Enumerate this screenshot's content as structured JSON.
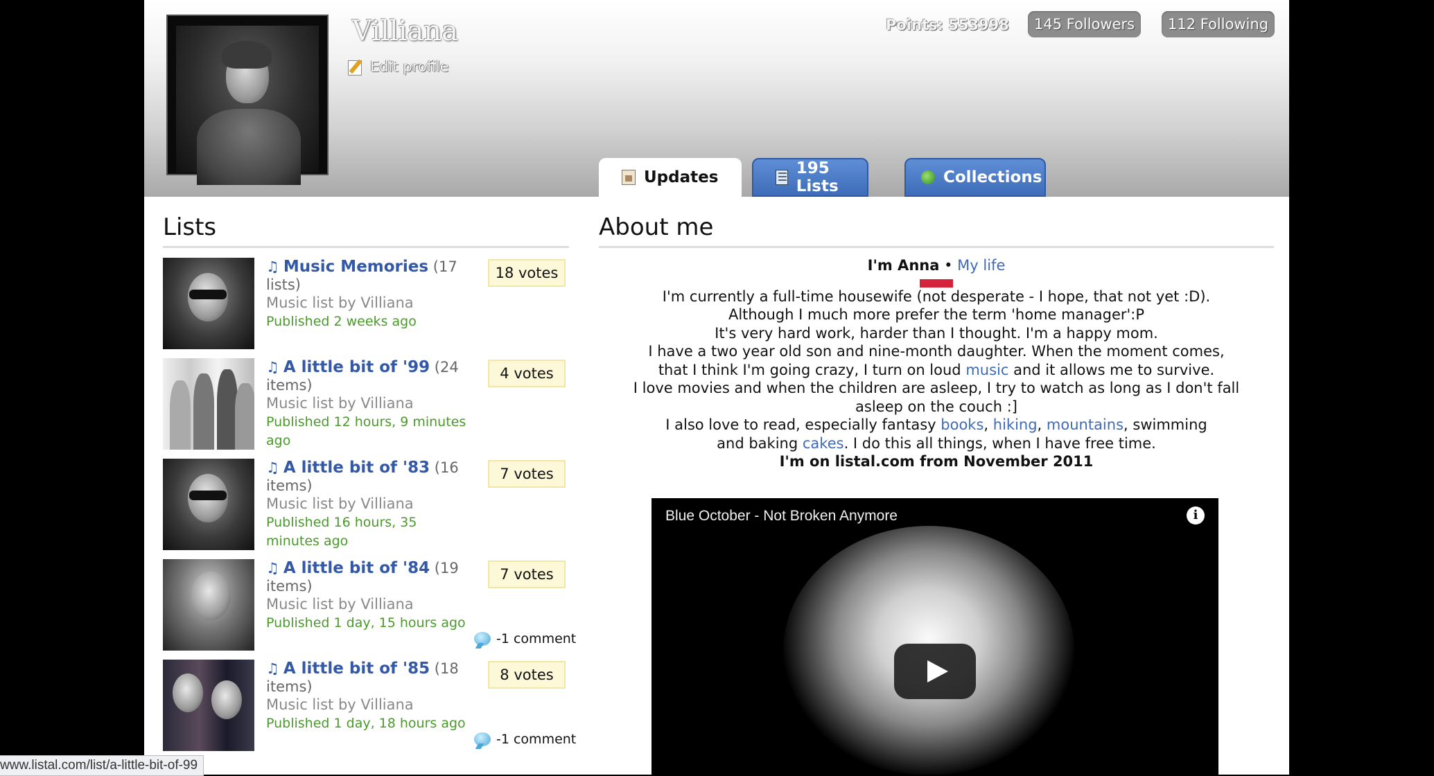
{
  "profile": {
    "username": "Villiana",
    "edit_profile": "Edit profile",
    "points": "Points: 553998",
    "followers": "145 Followers",
    "following": "112 Following"
  },
  "tabs": [
    {
      "label": "Updates"
    },
    {
      "label": "195 Lists"
    },
    {
      "label": "Collections"
    }
  ],
  "lists_section": {
    "title": "Lists",
    "items": [
      {
        "title": "Music Memories",
        "count": "(17 lists)",
        "by": "Music list by Villiana",
        "published": "Published 2 weeks ago",
        "votes": "18 votes",
        "comment": ""
      },
      {
        "title": "A little bit of '99",
        "count": "(24 items)",
        "by": "Music list by Villiana",
        "published": "Published 12 hours, 9 minutes ago",
        "votes": "4 votes",
        "comment": ""
      },
      {
        "title": "A little bit of '83",
        "count": "(16 items)",
        "by": "Music list by Villiana",
        "published": "Published 16 hours, 35 minutes ago",
        "votes": "7 votes",
        "comment": ""
      },
      {
        "title": "A little bit of '84",
        "count": "(19 items)",
        "by": "Music list by Villiana",
        "published": "Published 1 day, 15 hours ago",
        "votes": "7 votes",
        "comment": "-1 comment"
      },
      {
        "title": "A little bit of '85",
        "count": "(18 items)",
        "by": "Music list by Villiana",
        "published": "Published 1 day, 18 hours ago",
        "votes": "8 votes",
        "comment": "-1 comment"
      }
    ]
  },
  "about": {
    "title": "About me",
    "intro_name": "I'm Anna",
    "intro_sep": "•",
    "intro_link": "My life",
    "line1": "I'm currently a full-time housewife (not desperate - I hope, that not yet :D).",
    "line2": "Although I much more prefer the term 'home manager':P",
    "line3": "It's very hard work, harder than I thought. I'm a happy mom.",
    "line4": "I have a two year old son and nine-month daughter. When the moment comes,",
    "line5_pre": "that I think I'm going crazy, I turn on loud ",
    "line5_link": "music",
    "line5_post": " and it allows me to survive.",
    "line6": "I love movies and when the children are asleep, I try to watch as long as I don't fall asleep on the couch :]",
    "line7_pre": "I also love to read, especially fantasy ",
    "link_books": "books",
    "comma1": ", ",
    "link_hiking": "hiking",
    "comma2": ", ",
    "link_mountains": "mountains",
    "line7_post": ", swimming",
    "line8_pre": "and baking ",
    "link_cakes": "cakes",
    "line8_post": ". I do this all things, when I have free time.",
    "line9": "I'm on listal.com from November 2011"
  },
  "video": {
    "title": "Blue October - Not Broken Anymore",
    "info": "i"
  },
  "status_bar": {
    "url": "www.listal.com/list/a-little-bit-of-99"
  }
}
